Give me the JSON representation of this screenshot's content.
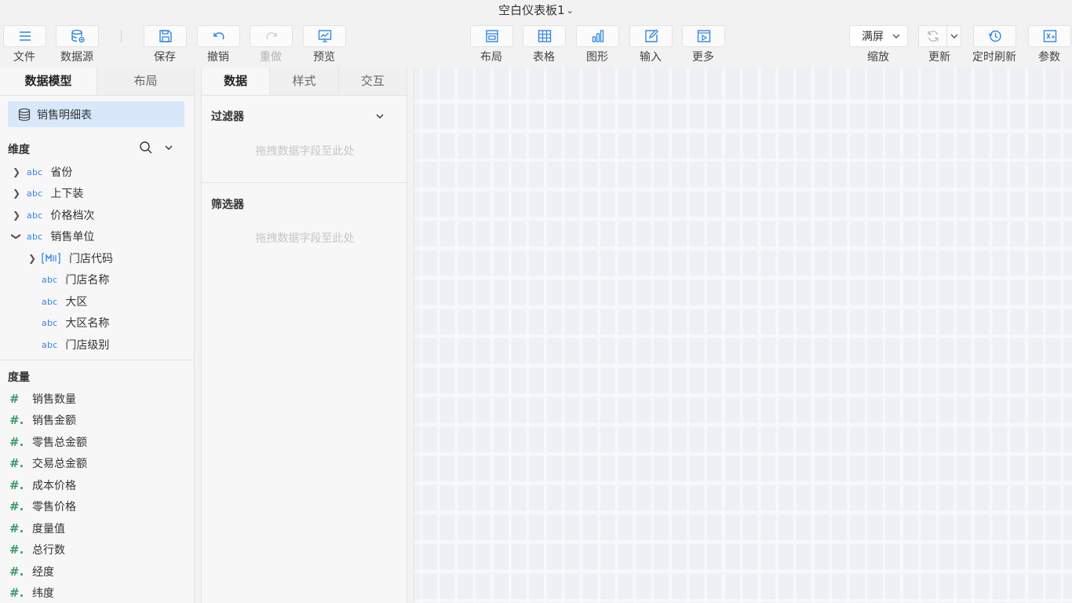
{
  "title": "空白仪表板1",
  "toolbar": {
    "file": "文件",
    "datasource": "数据源",
    "save": "保存",
    "undo": "撤销",
    "redo": "重做",
    "preview": "预览",
    "layout": "布局",
    "table": "表格",
    "chart": "图形",
    "input": "输入",
    "more": "更多",
    "zoom_value": "满屏",
    "zoom": "缩放",
    "refresh": "更新",
    "timed_refresh": "定时刷新",
    "params": "参数"
  },
  "left_panel": {
    "tabs": [
      "数据模型",
      "布局"
    ],
    "dataset": "销售明细表",
    "dimension_title": "维度",
    "dimensions": [
      {
        "label": "省份",
        "type": "abc",
        "expand": "collapsed"
      },
      {
        "label": "上下装",
        "type": "abc",
        "expand": "collapsed"
      },
      {
        "label": "价格档次",
        "type": "abc",
        "expand": "collapsed"
      },
      {
        "label": "销售单位",
        "type": "abc",
        "expand": "expanded"
      },
      {
        "label": "门店代码",
        "type": "hier",
        "expand": "collapsed"
      },
      {
        "label": "门店名称",
        "type": "abc",
        "expand": "none"
      },
      {
        "label": "大区",
        "type": "abc",
        "expand": "none"
      },
      {
        "label": "大区名称",
        "type": "abc",
        "expand": "none"
      },
      {
        "label": "门店级别",
        "type": "abc",
        "expand": "none"
      }
    ],
    "measure_title": "度量",
    "measures": [
      "销售数量",
      "销售金额",
      "零售总金额",
      "交易总金额",
      "成本价格",
      "零售价格",
      "度量值",
      "总行数",
      "经度",
      "纬度"
    ]
  },
  "mid_panel": {
    "tabs": [
      "数据",
      "样式",
      "交互"
    ],
    "filter_title": "过滤器",
    "filter_hint": "拖拽数据字段至此处",
    "selector_title": "筛选器",
    "selector_hint": "拖拽数据字段至此处"
  },
  "colors": {
    "accent": "#2f86e8",
    "measure_icon": "#3a9b6a",
    "dataset_bg": "#d8e8fb"
  }
}
